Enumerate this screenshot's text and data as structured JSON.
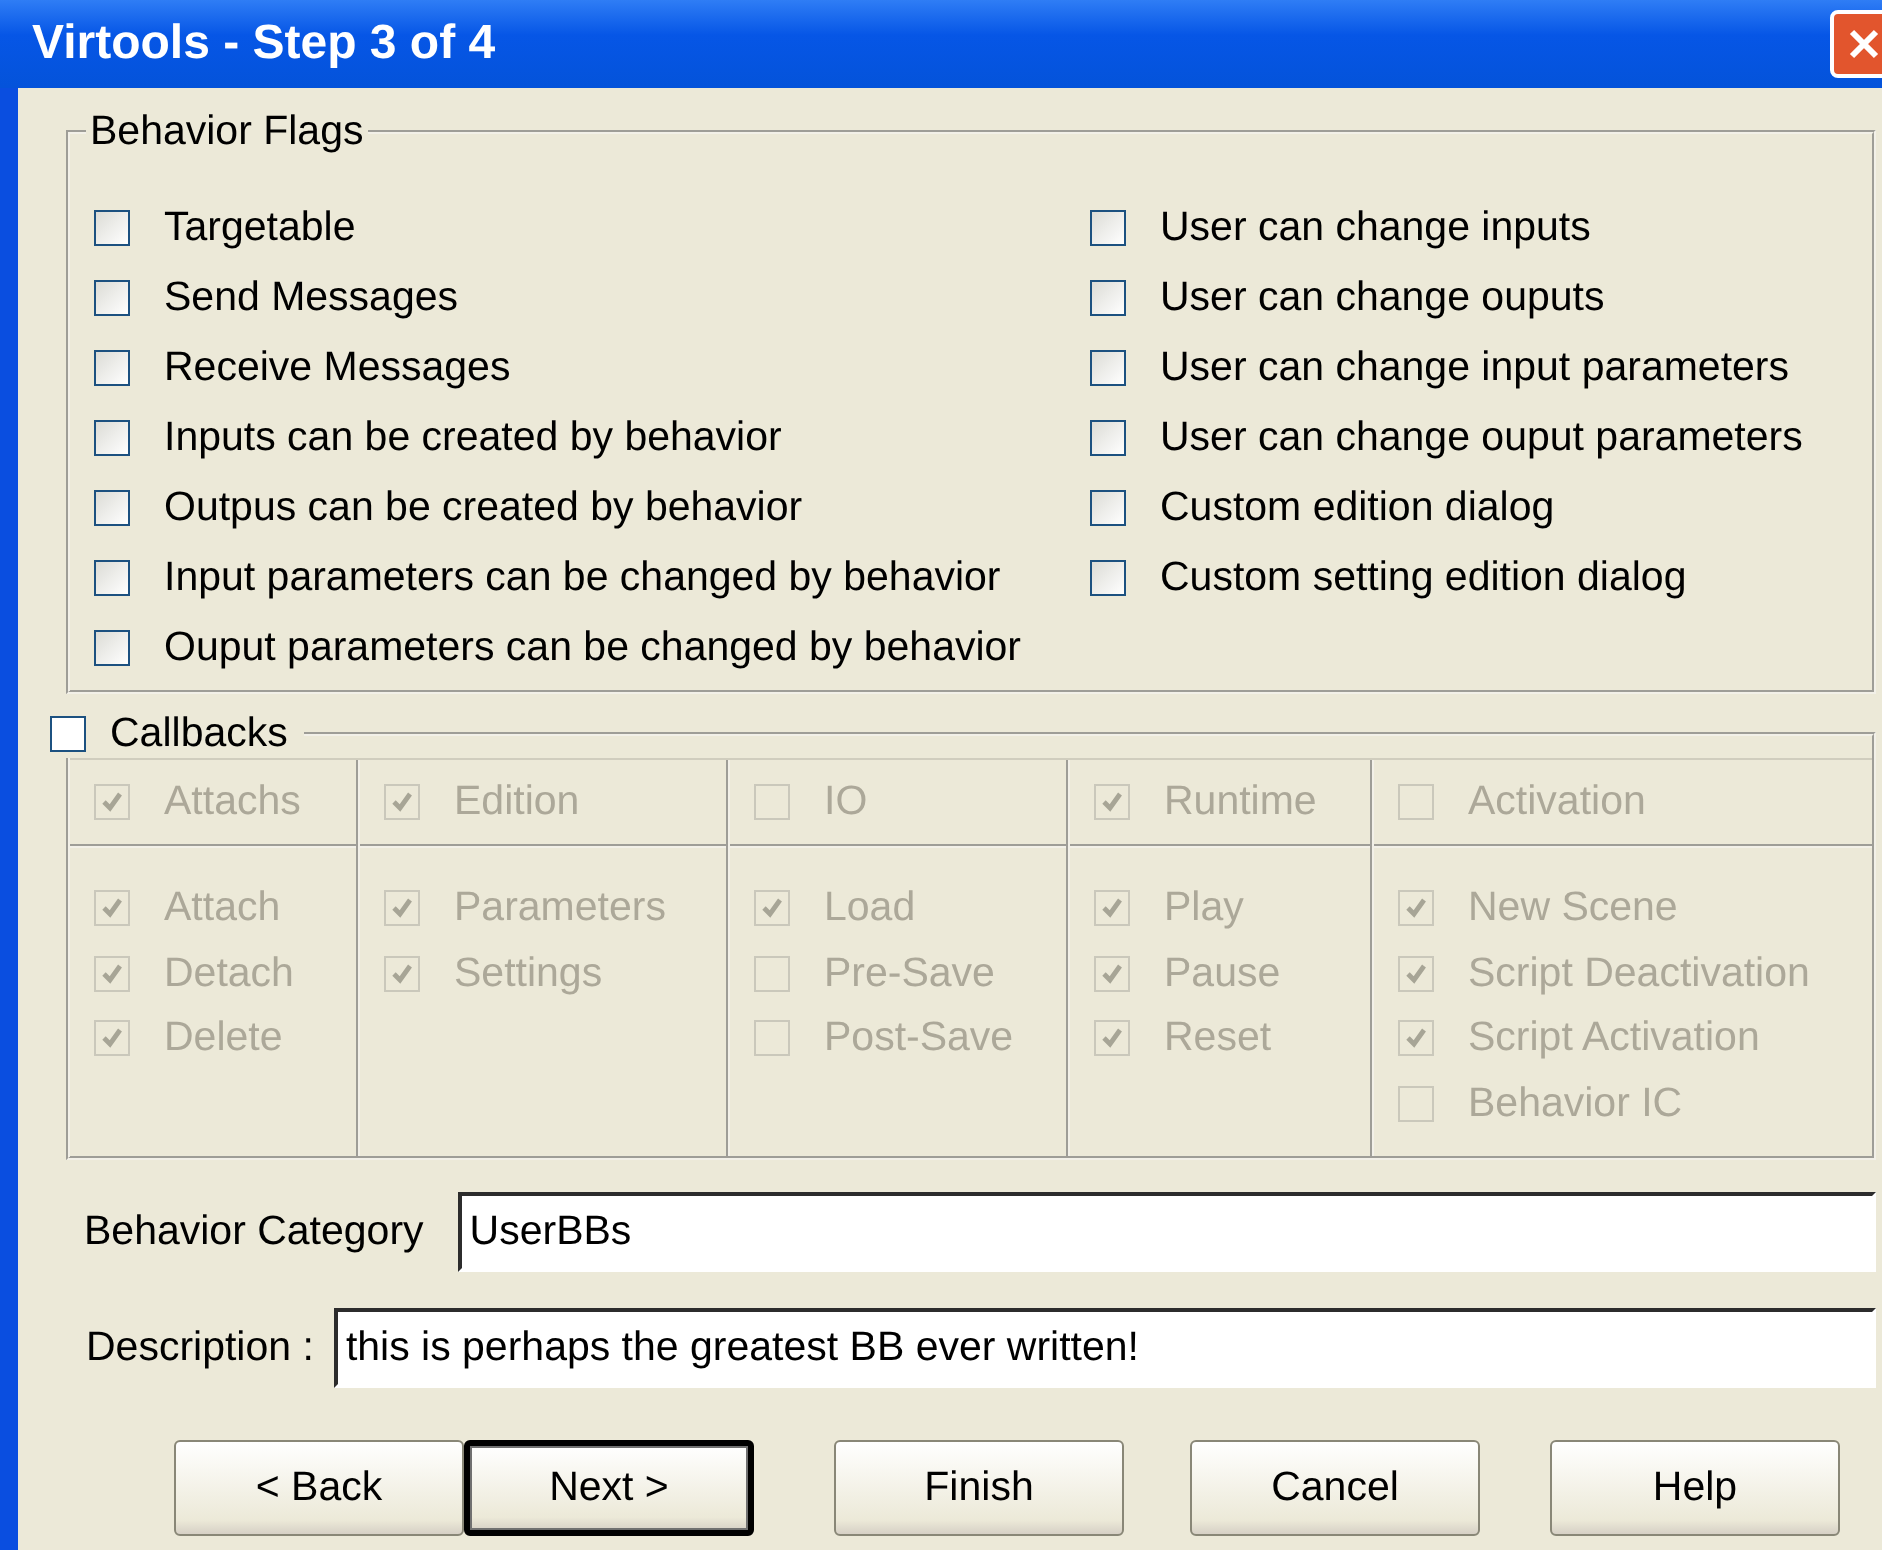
{
  "window": {
    "title": "Virtools - Step 3 of 4"
  },
  "behavior_flags": {
    "title": "Behavior Flags",
    "left": [
      {
        "label": "Targetable",
        "checked": false
      },
      {
        "label": "Send Messages",
        "checked": false
      },
      {
        "label": "Receive Messages",
        "checked": false
      },
      {
        "label": "Inputs can be created by behavior",
        "checked": false
      },
      {
        "label": "Outpus can be created by behavior",
        "checked": false
      },
      {
        "label": "Input parameters can be changed by behavior",
        "checked": false
      },
      {
        "label": "Ouput parameters can be changed by behavior",
        "checked": false
      }
    ],
    "right": [
      {
        "label": "User can change inputs",
        "checked": false
      },
      {
        "label": "User can change ouputs",
        "checked": false
      },
      {
        "label": "User can change input parameters",
        "checked": false
      },
      {
        "label": "User can change ouput parameters",
        "checked": false
      },
      {
        "label": "Custom edition dialog",
        "checked": false
      },
      {
        "label": "Custom setting edition dialog",
        "checked": false
      }
    ]
  },
  "callbacks": {
    "label": "Callbacks",
    "checked": false,
    "columns": [
      {
        "header": {
          "label": "Attachs",
          "checked": true
        },
        "items": [
          {
            "label": "Attach",
            "checked": true
          },
          {
            "label": "Detach",
            "checked": true
          },
          {
            "label": "Delete",
            "checked": true
          }
        ]
      },
      {
        "header": {
          "label": "Edition",
          "checked": true
        },
        "items": [
          {
            "label": "Parameters",
            "checked": true
          },
          {
            "label": "Settings",
            "checked": true
          }
        ]
      },
      {
        "header": {
          "label": "IO",
          "checked": false
        },
        "items": [
          {
            "label": "Load",
            "checked": true
          },
          {
            "label": "Pre-Save",
            "checked": false
          },
          {
            "label": "Post-Save",
            "checked": false
          }
        ]
      },
      {
        "header": {
          "label": "Runtime",
          "checked": true
        },
        "items": [
          {
            "label": "Play",
            "checked": true
          },
          {
            "label": "Pause",
            "checked": true
          },
          {
            "label": "Reset",
            "checked": true
          }
        ]
      },
      {
        "header": {
          "label": "Activation",
          "checked": false
        },
        "items": [
          {
            "label": "New Scene",
            "checked": true
          },
          {
            "label": "Script Deactivation",
            "checked": true
          },
          {
            "label": "Script Activation",
            "checked": true
          },
          {
            "label": "Behavior IC",
            "checked": false
          }
        ]
      }
    ]
  },
  "fields": [
    {
      "label": "Behavior Category",
      "value": "UserBBs"
    },
    {
      "label": "Description :",
      "value": "this is perhaps the greatest BB ever written!"
    }
  ],
  "buttons": [
    {
      "label": "< Back",
      "default": false
    },
    {
      "label": "Next >",
      "default": true
    },
    {
      "label": "Finish",
      "default": false
    },
    {
      "label": "Cancel",
      "default": false
    },
    {
      "label": "Help",
      "default": false
    }
  ]
}
